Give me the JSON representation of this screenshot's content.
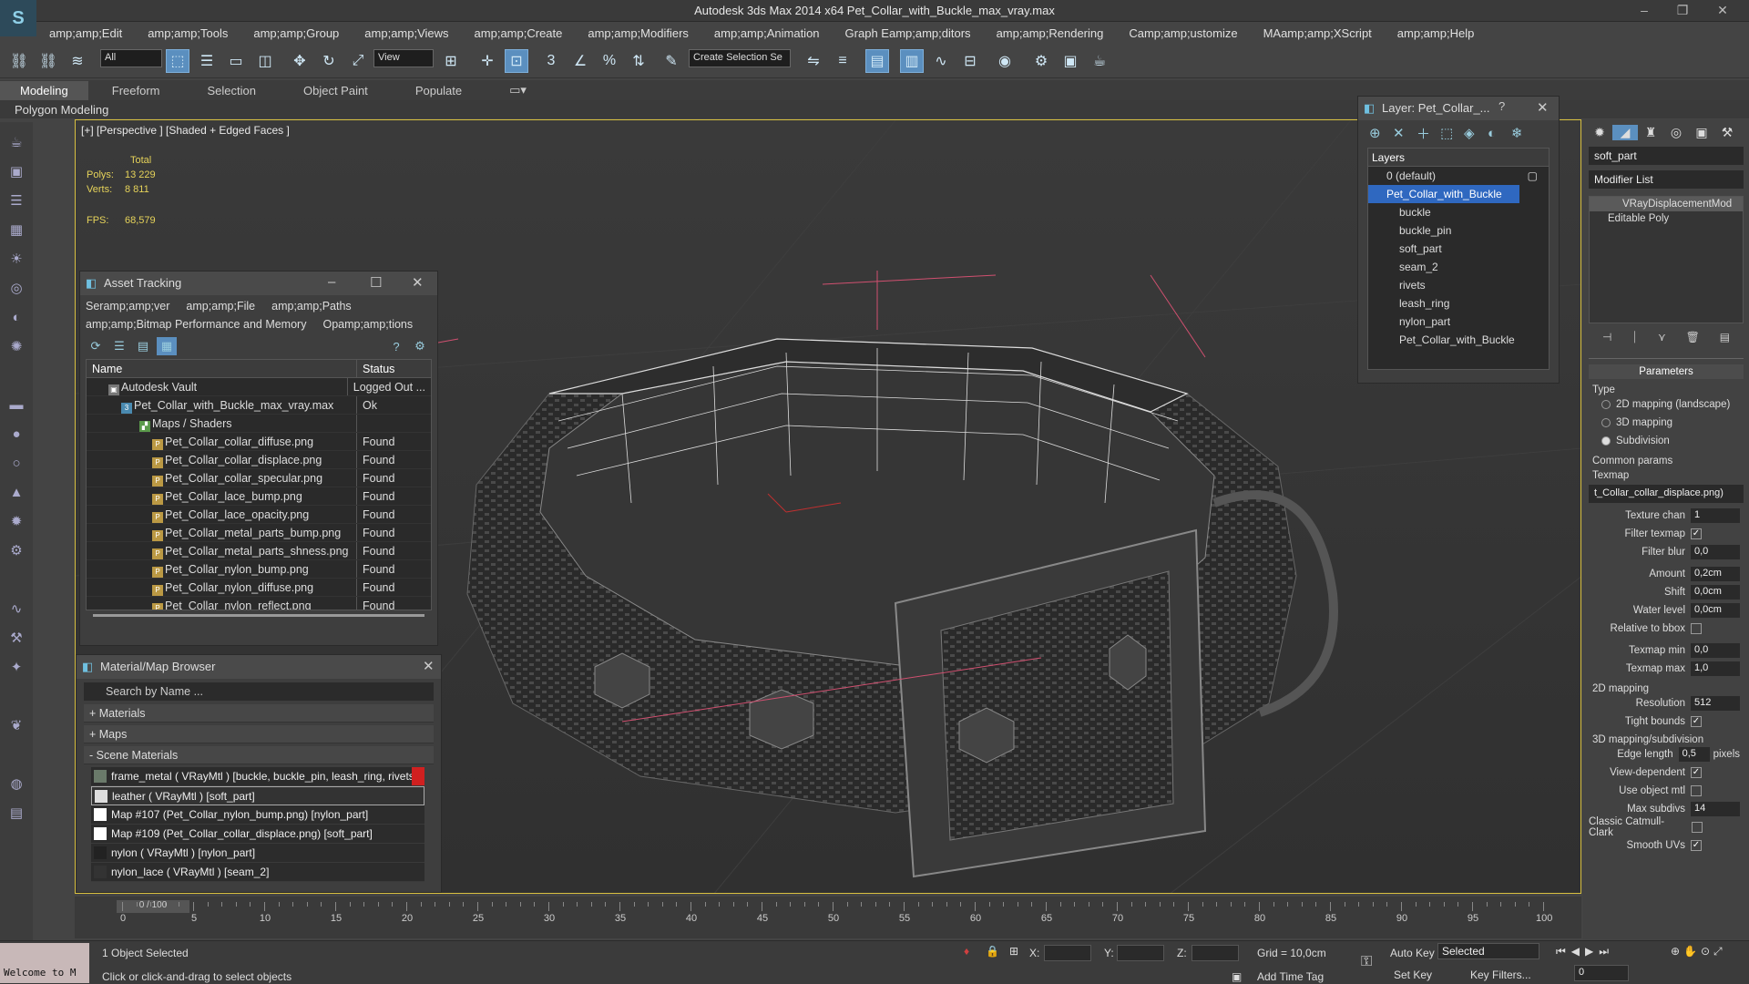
{
  "app": {
    "title": "Autodesk 3ds Max  2014 x64     Pet_Collar_with_Buckle_max_vray.max"
  },
  "menu": [
    "amp;amp;Edit",
    "amp;amp;Tools",
    "amp;amp;Group",
    "amp;amp;Views",
    "amp;amp;Create",
    "amp;amp;Modifiers",
    "amp;amp;Animation",
    "Graph Eamp;amp;ditors",
    "amp;amp;Rendering",
    "Camp;amp;ustomize",
    "MAamp;amp;XScript",
    "amp;amp;Help"
  ],
  "toolbar": {
    "filter": "All",
    "refcoord": "View",
    "selset": "Create Selection Se"
  },
  "ribbon": {
    "tabs": [
      "Modeling",
      "Freeform",
      "Selection",
      "Object Paint",
      "Populate"
    ],
    "sub": "Polygon Modeling"
  },
  "viewport": {
    "label": "[+] [Perspective ] [Shaded + Edged Faces ]",
    "stats": {
      "total": "Total",
      "polys_label": "Polys:",
      "polys": "13 229",
      "verts_label": "Verts:",
      "verts": "8 811",
      "fps_label": "FPS:",
      "fps": "68,579"
    }
  },
  "asset_tracking": {
    "title": "Asset Tracking",
    "menu": [
      "Seramp;amp;ver",
      "amp;amp;File",
      "amp;amp;Paths",
      "amp;amp;Bitmap Performance and Memory",
      "Opamp;amp;tions"
    ],
    "columns": [
      "Name",
      "Status"
    ],
    "rows": [
      {
        "name": "Autodesk Vault",
        "status": "Logged Out ..."
      },
      {
        "name": "Pet_Collar_with_Buckle_max_vray.max",
        "status": "Ok"
      },
      {
        "name": "Maps / Shaders",
        "status": ""
      },
      {
        "name": "Pet_Collar_collar_diffuse.png",
        "status": "Found"
      },
      {
        "name": "Pet_Collar_collar_displace.png",
        "status": "Found"
      },
      {
        "name": "Pet_Collar_collar_specular.png",
        "status": "Found"
      },
      {
        "name": "Pet_Collar_lace_bump.png",
        "status": "Found"
      },
      {
        "name": "Pet_Collar_lace_opacity.png",
        "status": "Found"
      },
      {
        "name": "Pet_Collar_metal_parts_bump.png",
        "status": "Found"
      },
      {
        "name": "Pet_Collar_metal_parts_shness.png",
        "status": "Found"
      },
      {
        "name": "Pet_Collar_nylon_bump.png",
        "status": "Found"
      },
      {
        "name": "Pet_Collar_nylon_diffuse.png",
        "status": "Found"
      },
      {
        "name": "Pet_Collar_nylon_reflect.png",
        "status": "Found"
      }
    ]
  },
  "material_browser": {
    "title": "Material/Map Browser",
    "search_placeholder": "Search by Name ...",
    "categories": [
      "+ Materials",
      "+ Maps",
      "- Scene Materials"
    ],
    "items": [
      "frame_metal  ( VRayMtl ) [buckle, buckle_pin, leash_ring, rivets]",
      "leather  ( VRayMtl ) [soft_part]",
      "Map #107 (Pet_Collar_nylon_bump.png) [nylon_part]",
      "Map #109 (Pet_Collar_collar_displace.png) [soft_part]",
      "nylon  ( VRayMtl ) [nylon_part]",
      "nylon_lace  ( VRayMtl ) [seam_2]"
    ]
  },
  "layer_window": {
    "title": "Layer: Pet_Collar_...",
    "header": "Layers",
    "rows": [
      "0 (default)",
      "Pet_Collar_with_Buckle",
      "buckle",
      "buckle_pin",
      "soft_part",
      "seam_2",
      "rivets",
      "leash_ring",
      "nylon_part",
      "Pet_Collar_with_Buckle"
    ]
  },
  "command_panel": {
    "object_name": "soft_part",
    "modifier_list": "Modifier List",
    "stack": [
      "VRayDisplacementMod",
      "Editable Poly"
    ],
    "params_title": "Parameters",
    "type_label": "Type",
    "types": [
      "2D mapping (landscape)",
      "3D mapping",
      "Subdivision"
    ],
    "common": "Common params",
    "texmap_label": "Texmap",
    "texmap": "t_Collar_collar_displace.png)",
    "rows": [
      {
        "label": "Texture chan",
        "value": "1"
      },
      {
        "label": "Filter texmap",
        "check": "✓"
      },
      {
        "label": "Filter blur",
        "value": "0,0"
      },
      {
        "label": "Amount",
        "value": "0,2cm"
      },
      {
        "label": "Shift",
        "value": "0,0cm"
      },
      {
        "label": "Water level",
        "value": "0,0cm"
      },
      {
        "label": "Relative to bbox",
        "check": ""
      },
      {
        "label": "Texmap min",
        "value": "0,0"
      },
      {
        "label": "Texmap max",
        "value": "1,0"
      }
    ],
    "sec2d": "2D mapping",
    "resolution_label": "Resolution",
    "resolution": "512",
    "tight_label": "Tight bounds",
    "sec3d": "3D mapping/subdivision",
    "edge_label": "Edge length",
    "edge": "0,5",
    "pixels": "pixels",
    "viewdep": "View-dependent",
    "useobj": "Use object mtl",
    "maxsub_label": "Max subdivs",
    "maxsub": "14",
    "classic": "Classic Catmull-Clark",
    "smooth": "Smooth UVs"
  },
  "timeline": {
    "frame": "0 / 100",
    "ticks": [
      "0",
      "5",
      "10",
      "15",
      "20",
      "25",
      "30",
      "35",
      "40",
      "45",
      "50",
      "55",
      "60",
      "65",
      "70",
      "75",
      "80",
      "85",
      "90",
      "95",
      "100"
    ]
  },
  "status": {
    "welcome": "Welcome to M",
    "selected": "1 Object Selected",
    "hint": "Click or click-and-drag to select objects",
    "x": "X:",
    "y": "Y:",
    "z": "Z:",
    "grid": "Grid = 10,0cm",
    "autokey": "Auto Key",
    "setkey": "Set Key",
    "selmode": "Selected",
    "keyfilters": "Key Filters...",
    "addtimetag": "Add Time Tag",
    "frame": "0"
  }
}
